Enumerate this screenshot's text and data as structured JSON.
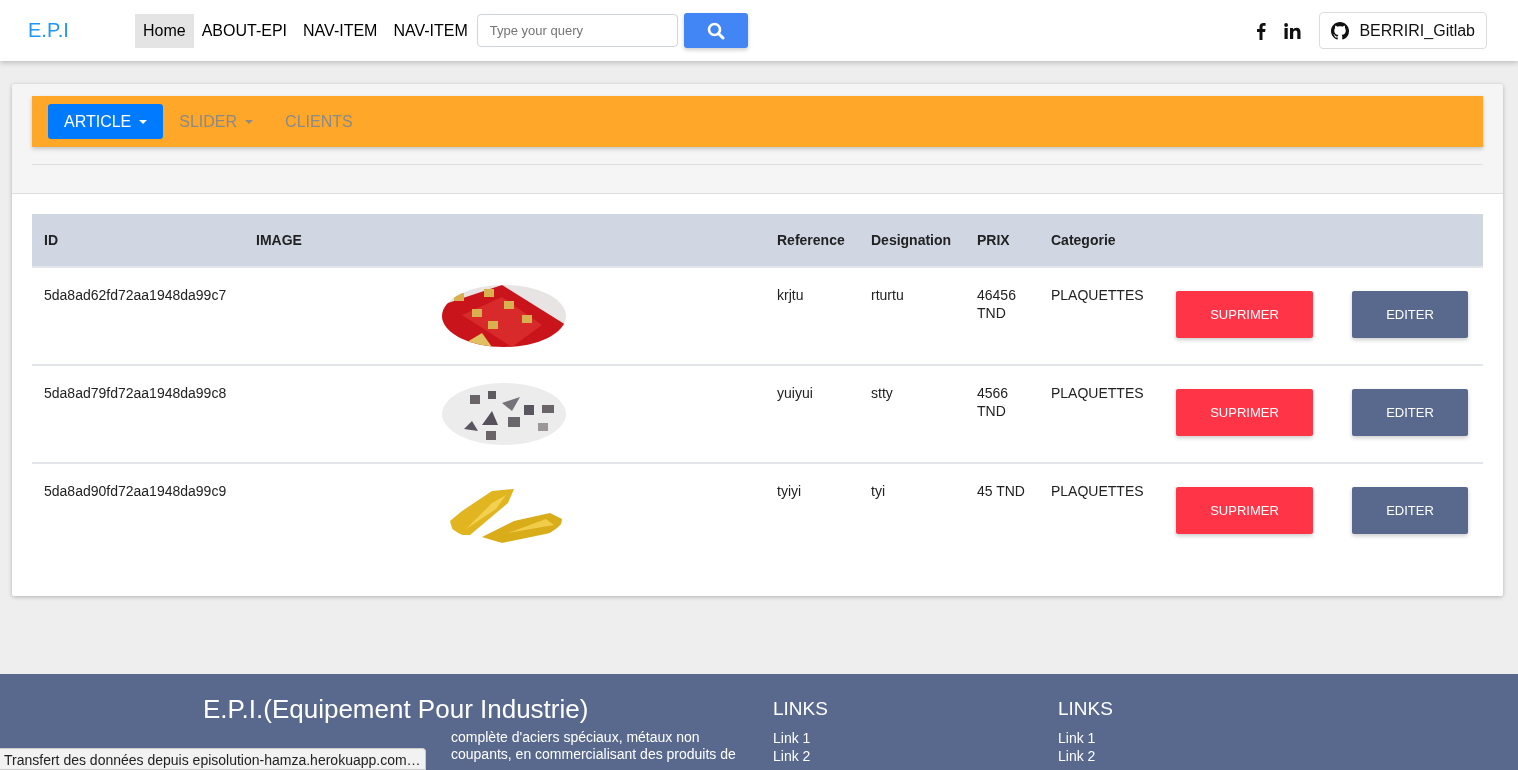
{
  "header": {
    "brand": "E.P.I",
    "nav": [
      {
        "label": "Home",
        "selected": true
      },
      {
        "label": "ABOUT-EPI",
        "selected": false
      },
      {
        "label": "NAV-ITEM",
        "selected": false
      },
      {
        "label": "NAV-ITEM",
        "selected": false
      }
    ],
    "search": {
      "placeholder": "Type your query"
    },
    "gitlab_button": "BERRIRI_Gitlab"
  },
  "tabs": [
    {
      "label": "ARTICLE",
      "selected": true,
      "dropdown": true
    },
    {
      "label": "SLIDER",
      "selected": false,
      "dropdown": true
    },
    {
      "label": "CLIENTS",
      "selected": false,
      "dropdown": false
    }
  ],
  "table": {
    "columns": [
      "ID",
      "IMAGE",
      "Reference",
      "Designation",
      "PRIX",
      "Categorie"
    ],
    "rows": [
      {
        "id": "5da8ad62fd72aa1948da99c7",
        "reference": "krjtu",
        "designation": "rturtu",
        "prix": "46456 TND",
        "categorie": "PLAQUETTES",
        "delete": "SUPRIMER",
        "edit": "EDITER"
      },
      {
        "id": "5da8ad79fd72aa1948da99c8",
        "reference": "yuiyui",
        "designation": "stty",
        "prix": "4566 TND",
        "categorie": "PLAQUETTES",
        "delete": "SUPRIMER",
        "edit": "EDITER"
      },
      {
        "id": "5da8ad90fd72aa1948da99c9",
        "reference": "tyiyi",
        "designation": "tyi",
        "prix": "45 TND",
        "categorie": "PLAQUETTES",
        "delete": "SUPRIMER",
        "edit": "EDITER"
      }
    ]
  },
  "footer": {
    "title": "E.P.I.(Equipement Pour Industrie)",
    "text_lines": [
      "complète d'aciers spéciaux, métaux non",
      "coupants, en commercialisant des produits de"
    ],
    "link_columns": [
      {
        "title": "LINKS",
        "links": [
          "Link 1",
          "Link 2"
        ]
      },
      {
        "title": "LINKS",
        "links": [
          "Link 1",
          "Link 2"
        ]
      }
    ]
  },
  "status_bar": "Transfert des données depuis episolution-hamza.herokuapp.com…"
}
